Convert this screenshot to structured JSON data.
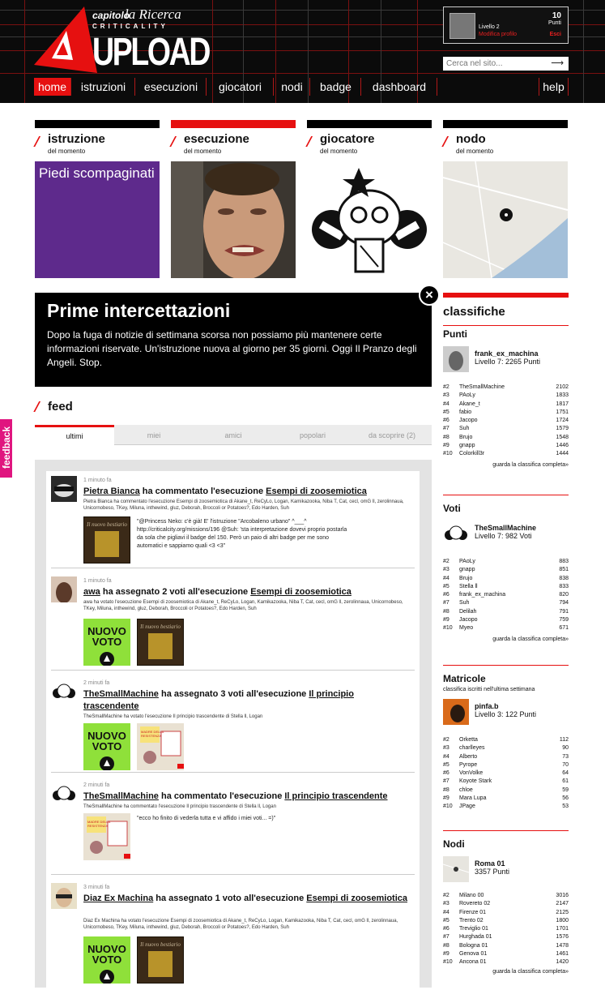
{
  "header": {
    "logo": {
      "capitolo": "capitolo",
      "ricerca": "la Ricerca",
      "criticality": "CRITICALITY",
      "upload": "UPLOAD"
    },
    "user": {
      "level": "Livello 2",
      "edit_profile": "Modifica profilo",
      "points": "10",
      "points_label": "Punti",
      "logout": "Esci"
    },
    "search": {
      "placeholder": "Cerca nel sito..."
    },
    "nav": [
      "home",
      "istruzioni",
      "esecuzioni",
      "giocatori",
      "nodi",
      "badge",
      "dashboard"
    ],
    "help": "help"
  },
  "cards": [
    {
      "title": "istruzione",
      "sub": "del momento",
      "content": "Piedi scompaginati"
    },
    {
      "title": "esecuzione",
      "sub": "del momento"
    },
    {
      "title": "giocatore",
      "sub": "del momento"
    },
    {
      "title": "nodo",
      "sub": "del momento"
    }
  ],
  "alert": {
    "title": "Prime intercettazioni",
    "text": "Dopo la fuga di notizie di settimana scorsa non possiamo più mantenere certe informazioni riservate. Un'istruzione nuova al giorno per 35 giorni. Oggi Il Pranzo degli Angeli. Stop."
  },
  "feed": {
    "title": "feed",
    "tabs": [
      "ultimi",
      "miei",
      "amici",
      "popolari",
      "da scoprire (2)"
    ],
    "items": [
      {
        "time": "1 minuto fa",
        "user": "Pietra Bianca",
        "action": "ha commentato l'esecuzione",
        "target": "Esempi di zoosemiotica",
        "desc": "Pietra Bianca ha commentato l'esecuzione Esempi di zoosemiotica di Akane_t, ReCyLo, Logan, Kamikazooka, Niba T, Cat, cecl, omG ll, zerolinnaua, Unicornobeso, TKey, Miluna, inthewind, gluz, Deborah, Broccoli or Potatoes?, Edo Harden, Suh",
        "quote": "\"@Princess Neko: c'è già! E' l'istruzione \"Arcobaleno urbano\" ^___^ http://criticalcity.org/missions/196 @Suh: 'sta interpretazione dovevi proprio postarla da sola che pigliavi il badge del 150. Però un paio di altri badge per me sono automatici e sappiamo quali <3 <3\"",
        "book": "Il nuovo bestiario"
      },
      {
        "time": "1 minuto fa",
        "user": "awa",
        "action": "ha assegnato 2 voti all'esecuzione",
        "target": "Esempi di zoosemiotica",
        "desc": "awa ha votato l'esecuzione Esempi di zoosemiotica di Akane_t, ReCyLo, Logan, Kamikazooka, Niba T, Cat, cecl, omG ll, zerolinnaua, Unicornobeso, TKey, Miluna, inthewind, gluz, Deborah, Broccoli or Potatoes?, Edo Harden, Suh",
        "badge": "NUOVO VOTO",
        "book": "Il nuovo bestiario"
      },
      {
        "time": "2 minuti fa",
        "user": "TheSmallMachine",
        "action": "ha assegnato 3 voti all'esecuzione",
        "target": "Il principio trascendente",
        "desc": "TheSmallMachine ha votato l'esecuzione Il principio trascendente di Stella ll, Logan",
        "badge": "NUOVO VOTO",
        "sticky": "MADRE DELLA RESISTENZA"
      },
      {
        "time": "2 minuti fa",
        "user": "TheSmallMachine",
        "action": "ha commentato l'esecuzione",
        "target": "Il principio trascendente",
        "desc": "TheSmallMachine ha commentato l'esecuzione Il principio trascendente di Stella ll, Logan",
        "quote": "\"ecco ho finito di vederla tutta e vi affido i miei voti... =)\"",
        "sticky": "MADRE DELLA RESISTENZA"
      },
      {
        "time": "3 minuti fa",
        "user": "Diaz Ex Machina",
        "action": "ha assegnato 1 voto all'esecuzione",
        "target": "Esempi di zoosemiotica",
        "desc": "Diaz Ex Machina ha votato l'esecuzione Esempi di zoosemiotica di Akane_t, ReCyLo, Logan, Kamikazooka, Niba T, Cat, cecl, omG ll, zerolinnaua, Unicornobeso, TKey, Miluna, inthewind, gluz, Deborah, Broccoli or Potatoes?, Edo Harden, Suh",
        "badge": "NUOVO VOTO",
        "book": "Il nuovo bestiario"
      }
    ]
  },
  "classifiche": {
    "title": "classifiche",
    "sections": [
      {
        "title": "Punti",
        "leader": {
          "name": "frank_ex_machina",
          "level": "Livello 7: 2265 Punti"
        },
        "rows": [
          [
            "#2",
            "TheSmallMachine",
            "2102"
          ],
          [
            "#3",
            "PAoLy",
            "1833"
          ],
          [
            "#4",
            "Akane_t",
            "1817"
          ],
          [
            "#5",
            "fabio",
            "1751"
          ],
          [
            "#6",
            "Jacopo",
            "1724"
          ],
          [
            "#7",
            "Suh",
            "1579"
          ],
          [
            "#8",
            "Brujo",
            "1548"
          ],
          [
            "#9",
            "gnapp",
            "1446"
          ],
          [
            "#10",
            "Colorkill3r",
            "1444"
          ]
        ],
        "more": "guarda la classifica completa»"
      },
      {
        "title": "Voti",
        "leader": {
          "name": "TheSmallMachine",
          "level": "Livello 7: 982 Voti"
        },
        "rows": [
          [
            "#2",
            "PAoLy",
            "883"
          ],
          [
            "#3",
            "gnapp",
            "851"
          ],
          [
            "#4",
            "Brujo",
            "838"
          ],
          [
            "#5",
            "Stella ll",
            "833"
          ],
          [
            "#6",
            "frank_ex_machina",
            "820"
          ],
          [
            "#7",
            "Suh",
            "794"
          ],
          [
            "#8",
            "Delilah",
            "791"
          ],
          [
            "#9",
            "Jacopo",
            "759"
          ],
          [
            "#10",
            "Myeo",
            "671"
          ]
        ],
        "more": "guarda la classifica completa»"
      },
      {
        "title": "Matricole",
        "sub": "classifica iscritti nell'ultima settimana",
        "leader": {
          "name": "pinfa.b",
          "level": "Livello 3: 122 Punti"
        },
        "rows": [
          [
            "#2",
            "Orketta",
            "112"
          ],
          [
            "#3",
            "charlleyes",
            "90"
          ],
          [
            "#4",
            "Alberto",
            "73"
          ],
          [
            "#5",
            "Pyrope",
            "70"
          ],
          [
            "#6",
            "VonVolke",
            "64"
          ],
          [
            "#7",
            "Koyote Stark",
            "61"
          ],
          [
            "#8",
            "chloe",
            "59"
          ],
          [
            "#9",
            "Mara Lupa",
            "56"
          ],
          [
            "#10",
            "JPage",
            "53"
          ]
        ]
      },
      {
        "title": "Nodi",
        "leader": {
          "name": "Roma 01",
          "level": "3357 Punti"
        },
        "rows": [
          [
            "#2",
            "Milano 00",
            "3016"
          ],
          [
            "#3",
            "Rovereto 02",
            "2147"
          ],
          [
            "#4",
            "Firenze 01",
            "2125"
          ],
          [
            "#5",
            "Trento 02",
            "1800"
          ],
          [
            "#6",
            "Treviglio 01",
            "1701"
          ],
          [
            "#7",
            "Hurghada 01",
            "1576"
          ],
          [
            "#8",
            "Bologna 01",
            "1478"
          ],
          [
            "#9",
            "Genova 01",
            "1461"
          ],
          [
            "#10",
            "Ancona 01",
            "1420"
          ]
        ],
        "more": "guarda la classifica completa»"
      }
    ]
  },
  "feedback": "feedback",
  "colors": {
    "accent": "#e61010",
    "header_bg": "#0b0b0b",
    "feedback": "#e0157f",
    "nuovo_voto": "#8fe03a"
  }
}
